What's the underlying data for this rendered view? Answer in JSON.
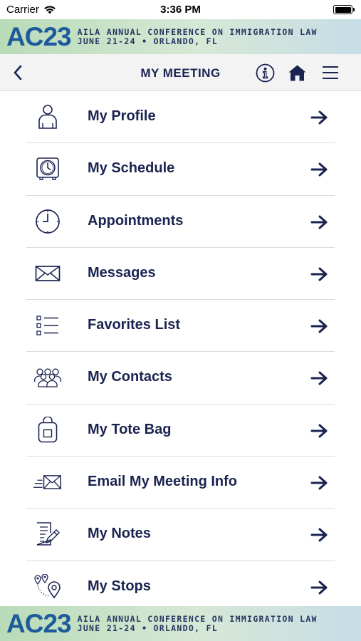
{
  "status_bar": {
    "carrier": "Carrier",
    "time": "3:36 PM"
  },
  "banner": {
    "logo": "AC23",
    "line1": "AILA ANNUAL CONFERENCE ON IMMIGRATION LAW",
    "line2": "JUNE 21-24 • ORLANDO, FL"
  },
  "nav": {
    "title": "MY MEETING",
    "back_icon": "chevron-left-icon",
    "info_icon": "info-circle-icon",
    "home_icon": "home-icon",
    "menu_icon": "hamburger-menu-icon"
  },
  "menu": {
    "items": [
      {
        "label": "My Profile",
        "icon": "person-icon"
      },
      {
        "label": "My Schedule",
        "icon": "clock-schedule-icon"
      },
      {
        "label": "Appointments",
        "icon": "clock-icon"
      },
      {
        "label": "Messages",
        "icon": "envelope-icon"
      },
      {
        "label": "Favorites List",
        "icon": "checklist-icon"
      },
      {
        "label": "My Contacts",
        "icon": "group-icon"
      },
      {
        "label": "My Tote Bag",
        "icon": "tote-bag-icon"
      },
      {
        "label": "Email My Meeting Info",
        "icon": "send-email-icon"
      },
      {
        "label": "My Notes",
        "icon": "notes-pencil-icon"
      },
      {
        "label": "My Stops",
        "icon": "map-pins-icon"
      }
    ],
    "arrow_icon": "arrow-right-icon"
  },
  "colors": {
    "text": "#1b2350",
    "logo": "#1d5b9c",
    "banner_green": "#b9dbb8",
    "banner_blue": "#c7dde6",
    "nav_bg": "#f3f3f3"
  }
}
